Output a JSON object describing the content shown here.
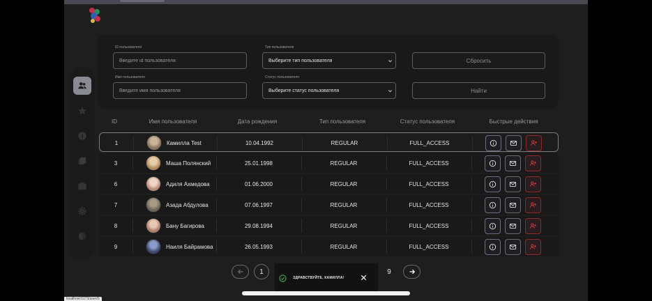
{
  "filters": {
    "user_id_label": "ID пользователя",
    "user_id_placeholder": "Введите id пользователя",
    "user_type_label": "Тип пользователя",
    "user_type_selected": "Выберите тип пользователя",
    "user_name_label": "Имя пользователя",
    "user_name_placeholder": "Введите имя пользователя",
    "user_status_label": "Статус пользователя",
    "user_status_selected": "Выберите статус пользователя",
    "reset_label": "Сбросить",
    "find_label": "Найти"
  },
  "table": {
    "headers": {
      "id": "ID",
      "name": "Имя пользователя",
      "birth": "Дата рождения",
      "type": "Тип пользователя",
      "status": "Статус пользователя",
      "actions": "Быстрые действия"
    },
    "rows": [
      {
        "id": "1",
        "name": "Камилла Test",
        "birth": "10.04.1992",
        "type": "REGULAR",
        "status": "FULL_ACCESS"
      },
      {
        "id": "3",
        "name": "Маша Полянский",
        "birth": "25.01.1998",
        "type": "REGULAR",
        "status": "FULL_ACCESS"
      },
      {
        "id": "6",
        "name": "Адиля Ахмедова",
        "birth": "01.06.2000",
        "type": "REGULAR",
        "status": "FULL_ACCESS"
      },
      {
        "id": "7",
        "name": "Азада Абдулова",
        "birth": "07.06.1997",
        "type": "REGULAR",
        "status": "FULL_ACCESS"
      },
      {
        "id": "8",
        "name": "Бану Багирова",
        "birth": "29.08.1994",
        "type": "REGULAR",
        "status": "FULL_ACCESS"
      },
      {
        "id": "9",
        "name": "Наиля Байрамова",
        "birth": "26.05.1993",
        "type": "REGULAR",
        "status": "FULL_ACCESS"
      }
    ]
  },
  "pagination": {
    "current": "1",
    "last": "9"
  },
  "toast": {
    "message": "ЗДРАВСТВУЙТЕ, КАМИЛЛА!"
  },
  "status_bar": {
    "url": "localhost:5173/user/0"
  },
  "colors": {
    "background": "#1e1e1f",
    "panel": "#19191a",
    "add_user_accent": "#c83a3a",
    "success": "#3fae5a"
  }
}
